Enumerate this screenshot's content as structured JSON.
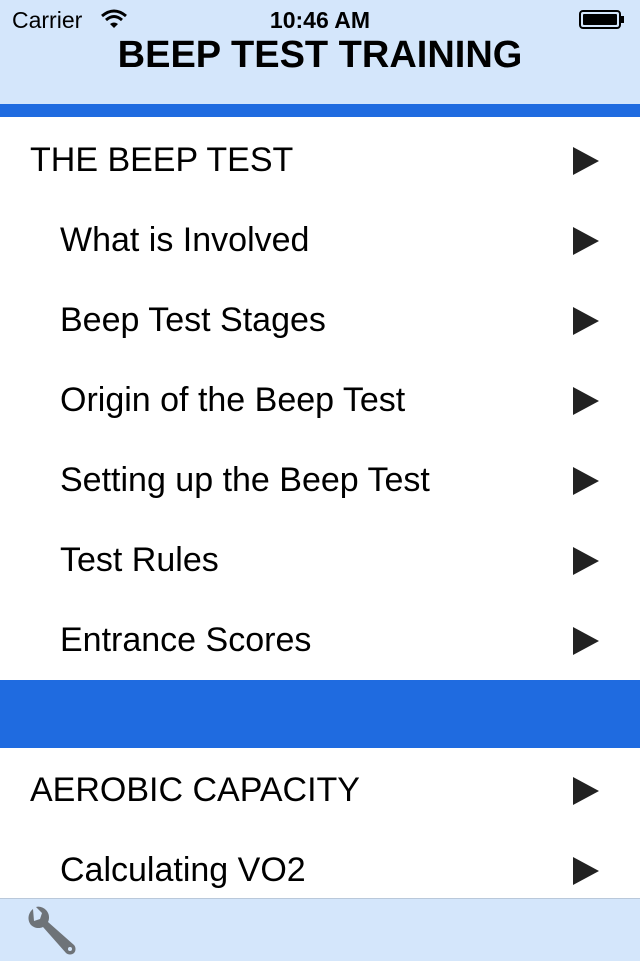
{
  "status_bar": {
    "carrier": "Carrier",
    "time": "10:46 AM",
    "icons": [
      "wifi-icon",
      "battery-icon"
    ]
  },
  "nav": {
    "title": "BEEP TEST TRAINING",
    "accent_color": "#1f6be0",
    "background_color": "#d4e6fb"
  },
  "sections": [
    {
      "header": "THE BEEP TEST",
      "items": [
        "What is Involved",
        "Beep Test Stages",
        "Origin of the Beep Test",
        "Setting up the Beep Test",
        "Test Rules",
        "Entrance Scores"
      ]
    },
    {
      "header": "AEROBIC CAPACITY",
      "items": [
        "Calculating VO2"
      ]
    }
  ],
  "row_icon": "play-arrow-icon",
  "toolbar": {
    "icons": [
      "wrench-icon"
    ]
  }
}
